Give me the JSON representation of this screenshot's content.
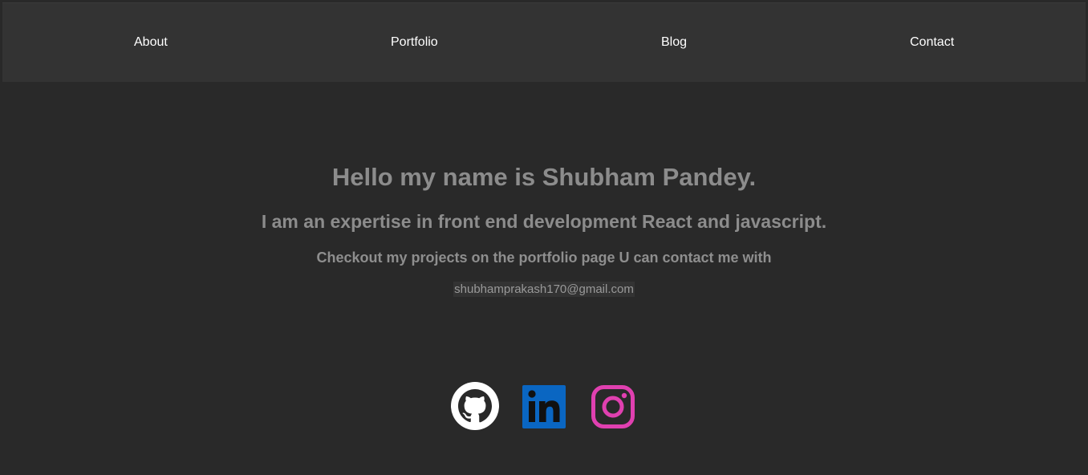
{
  "nav": {
    "items": [
      {
        "label": "About"
      },
      {
        "label": "Portfolio"
      },
      {
        "label": "Blog"
      },
      {
        "label": "Contact"
      }
    ]
  },
  "intro": {
    "title": "Hello my name is Shubham Pandey.",
    "subtitle": "I am an expertise in front end development React and javascript.",
    "text": "Checkout my projects on the portfolio page U can contact me with",
    "email": "shubhamprakash170@gmail.com"
  },
  "social": {
    "icons": [
      "github-icon",
      "linkedin-icon",
      "instagram-icon"
    ],
    "colors": {
      "github": "#ffffff",
      "linkedin": "#0a66c2",
      "instagram": "#e040b0"
    }
  },
  "colors": {
    "background": "#292929",
    "navbar": "#333333",
    "nav_text": "#ffffff",
    "intro_text": "#8c8c8c"
  }
}
